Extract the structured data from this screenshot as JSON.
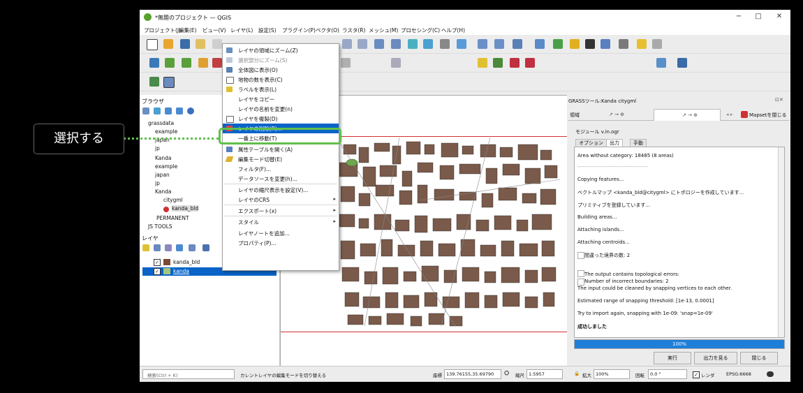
{
  "window": {
    "title": "*無題のプロジェクト — QGIS",
    "minimize": "−",
    "maximize": "□",
    "close": "✕"
  },
  "menubar": [
    "プロジェクト(J)",
    "編集(E)",
    "ビュー(V)",
    "レイヤ(L)",
    "設定(S)",
    "プラグイン(P)",
    "ベクタ(O)",
    "ラスタ(R)",
    "メッシュ(M)",
    "プロセシング(C)",
    "ヘルプ(H)"
  ],
  "browser": {
    "title": "ブラウザ",
    "items": [
      "grassdata",
      "example",
      "japan",
      "jp",
      "Kanda",
      "example",
      "japan",
      "jp",
      "Kanda",
      "citygml",
      "kanda_bld",
      "PERMANENT",
      "JS TOOLS"
    ]
  },
  "layers": {
    "title": "レイヤ",
    "items": [
      {
        "label": "kanda_bld",
        "color": "#7a4a34"
      },
      {
        "label": "kanda",
        "color": "#a6c77a"
      }
    ]
  },
  "context_menu": [
    "レイヤの領域にズーム(Z)",
    "選択部分にズーム(S)",
    "全体図に表示(O)",
    "地物の数を表示(C)",
    "ラベルを表示(L)",
    "レイヤをコピー",
    "レイヤの名前を変更(n)",
    "レイヤを複製(D)",
    "レイヤの削除(R)...",
    "一番上に移動(T)",
    "属性テーブルを開く(A)",
    "編集モード切替(E)",
    "フィルタ(F)...",
    "データソースを変更(h)...",
    "レイヤの縮尺表示を設定(V)...",
    "レイヤのCRS",
    "エクスポート(x)",
    "スタイル",
    "レイヤノートを追加...",
    "プロパティ(P)..."
  ],
  "callout": {
    "label": "選択する",
    "highlight_color": "#5fc04a"
  },
  "grass": {
    "panel_title": "GRASSツール:Kanda citygml",
    "tab_left": "領域",
    "tab_arrow1": "↗ → ⊕",
    "tab_arrow2": "↗ → ⊕",
    "mapset_button": "Mapsetを閉じる",
    "module_title": "モジュール v.in.ogr",
    "subtabs": [
      "オプション",
      "出力",
      "手動"
    ],
    "output_lines": [
      "Area without category: 18485 (8 areas)",
      "----------------------------------------",
      "Copying features...",
      "ベクトルマップ <kanda_bld@citygml> にトポロジーを作成しています...",
      "プリミティブを登録しています...",
      "Building areas...",
      "Attaching islands...",
      "Attaching centroids...",
      "間違った境界の数: 2",
      "The output contains topological errors:",
      "Number of incorrect boundaries: 2",
      "The input could be cleaned by snapping vertices to each other.",
      "Estimated range of snapping threshold: [1e-13, 0.0001]",
      "Try to import again, snapping with 1e-09: 'snap=1e-09'",
      "成功しました"
    ],
    "progress": {
      "label": "100%",
      "value": 1.0
    },
    "buttons": {
      "run": "実行",
      "view": "出力を見る",
      "close": "閉じる"
    }
  },
  "statusbar": {
    "search_placeholder": "検索(Ctrl + K)",
    "message": "カレントレイヤの編集モードを切り替える",
    "coord_label": "座標",
    "coord": "139.76155,35.69790",
    "scale_label": "縮尺",
    "scale": "1:5957",
    "magnify_label": "拡大",
    "magnify": "100%",
    "rotation_label": "回転",
    "rotation": "0.0 °",
    "render_label": "レンダ",
    "crs": "EPSG:6668"
  },
  "colors": {
    "building": "#7a5a4a",
    "park": "#6fa84a",
    "selection": "#0a64c8",
    "accent_green": "#5fc04a",
    "progress": "#1e7fd8"
  }
}
